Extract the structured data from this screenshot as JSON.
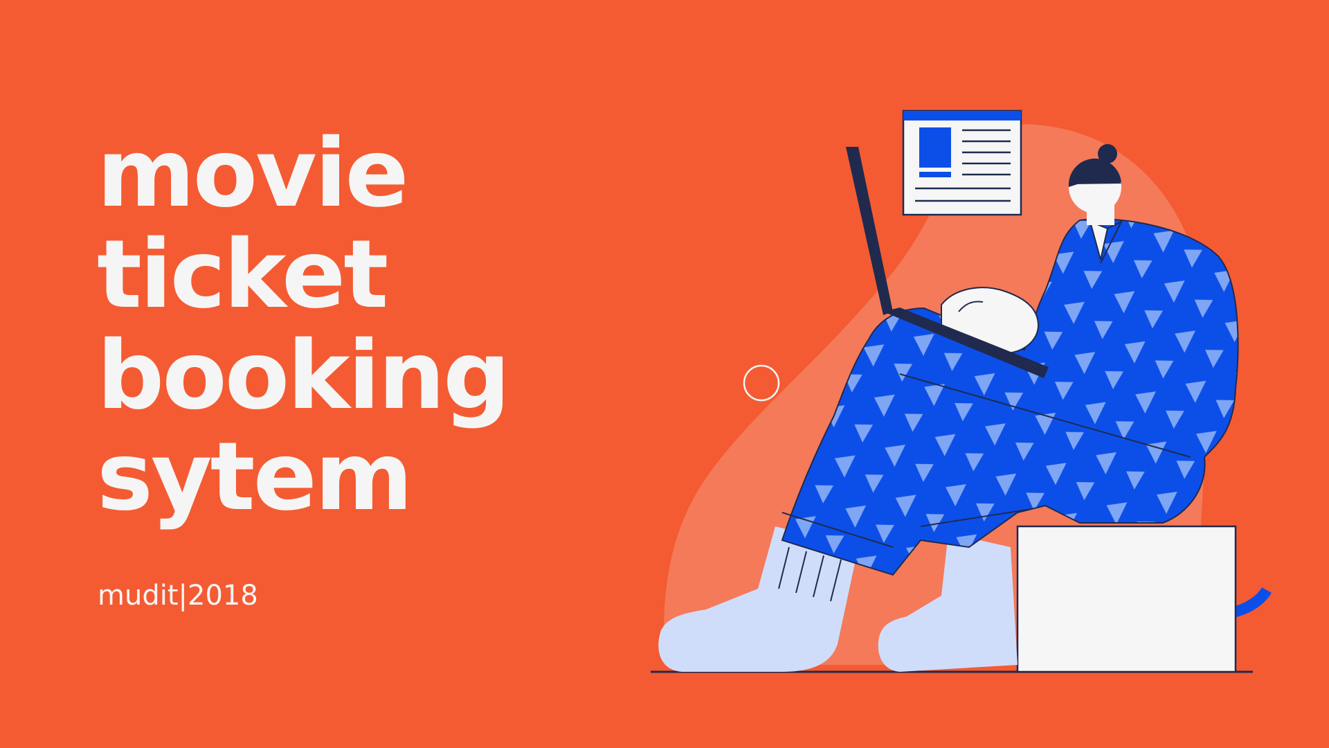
{
  "colors": {
    "background": "#F45B32",
    "blob": "#F47A5A",
    "text": "#F6F5F5",
    "pattern_blue": "#0C4FE8",
    "pattern_light": "#7FA6F5",
    "sock": "#CFDDFB",
    "navy": "#1F2A4E",
    "white": "#F6F6F6"
  },
  "title": {
    "lines": [
      "movie",
      "ticket",
      "booking",
      "sytem"
    ]
  },
  "credit": {
    "author": "mudit",
    "separator": "|",
    "year": "2018"
  },
  "illustration": {
    "subject": "person-sitting-with-laptop",
    "window_icon": "browser-window-icon",
    "ring_icon": "circle-outline-icon",
    "arc_icon": "open-ring-icon"
  }
}
